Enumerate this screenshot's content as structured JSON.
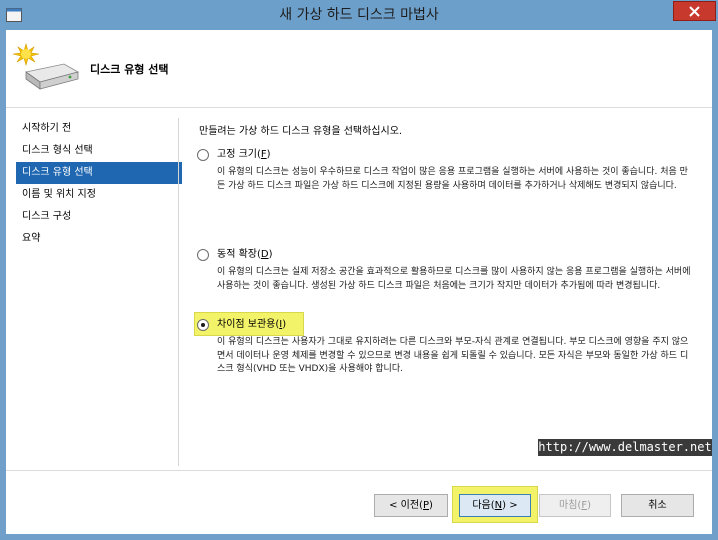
{
  "window": {
    "title": "새 가상 하드 디스크 마법사"
  },
  "header": {
    "title": "디스크 유형 선택"
  },
  "sidebar": {
    "items": [
      {
        "label": "시작하기 전"
      },
      {
        "label": "디스크 형식 선택"
      },
      {
        "label": "디스크 유형 선택",
        "active": true
      },
      {
        "label": "이름 및 위치 지정"
      },
      {
        "label": "디스크 구성"
      },
      {
        "label": "요약"
      }
    ]
  },
  "content": {
    "instruction": "만들려는 가상 하드 디스크 유형을 선택하십시오.",
    "options": [
      {
        "label": "고정 크기(",
        "accel": "F",
        "label_end": ")",
        "checked": false,
        "description": "이 유형의 디스크는 성능이 우수하므로 디스크 작업이 많은 응용 프로그램을 실행하는 서버에 사용하는 것이 좋습니다. 처음 만든 가상 하드 디스크 파일은 가상 하드 디스크에 지정된 용량을 사용하며 데이터를 추가하거나 삭제해도 변경되지 않습니다."
      },
      {
        "label": "동적 확장(",
        "accel": "D",
        "label_end": ")",
        "checked": false,
        "description": "이 유형의 디스크는 실제 저장소 공간을 효과적으로 활용하므로 디스크를 많이 사용하지 않는 응용 프로그램을 실행하는 서버에 사용하는 것이 좋습니다. 생성된 가상 하드 디스크 파일은 처음에는 크기가 작지만 데이터가 추가됨에 따라 변경됩니다."
      },
      {
        "label": "차이점 보관용(",
        "accel": "I",
        "label_end": ")",
        "checked": true,
        "description": "이 유형의 디스크는 사용자가 그대로 유지하려는 다른 디스크와 부모-자식 관계로 연결됩니다. 부모 디스크에 영향을 주지 않으면서 데이터나 운영 체제를 변경할 수 있으므로 변경 내용을 쉽게 되돌릴 수 있습니다. 모든 자식은 부모와 동일한 가상 하드 디스크 형식(VHD 또는 VHDX)을 사용해야 합니다."
      }
    ]
  },
  "watermark": "http://www.delmaster.net",
  "buttons": {
    "prev": {
      "label": "< 이전(",
      "accel": "P",
      "end": ")"
    },
    "next": {
      "label": "다음(",
      "accel": "N",
      "end": ") >"
    },
    "finish": {
      "label": "마침(",
      "accel": "F",
      "end": ")"
    },
    "cancel": {
      "label": "취소"
    }
  },
  "colors": {
    "titlebar": "#6d9fcb",
    "selection": "#1f67b1",
    "highlight": "#f3f36a",
    "close": "#c7392c"
  }
}
